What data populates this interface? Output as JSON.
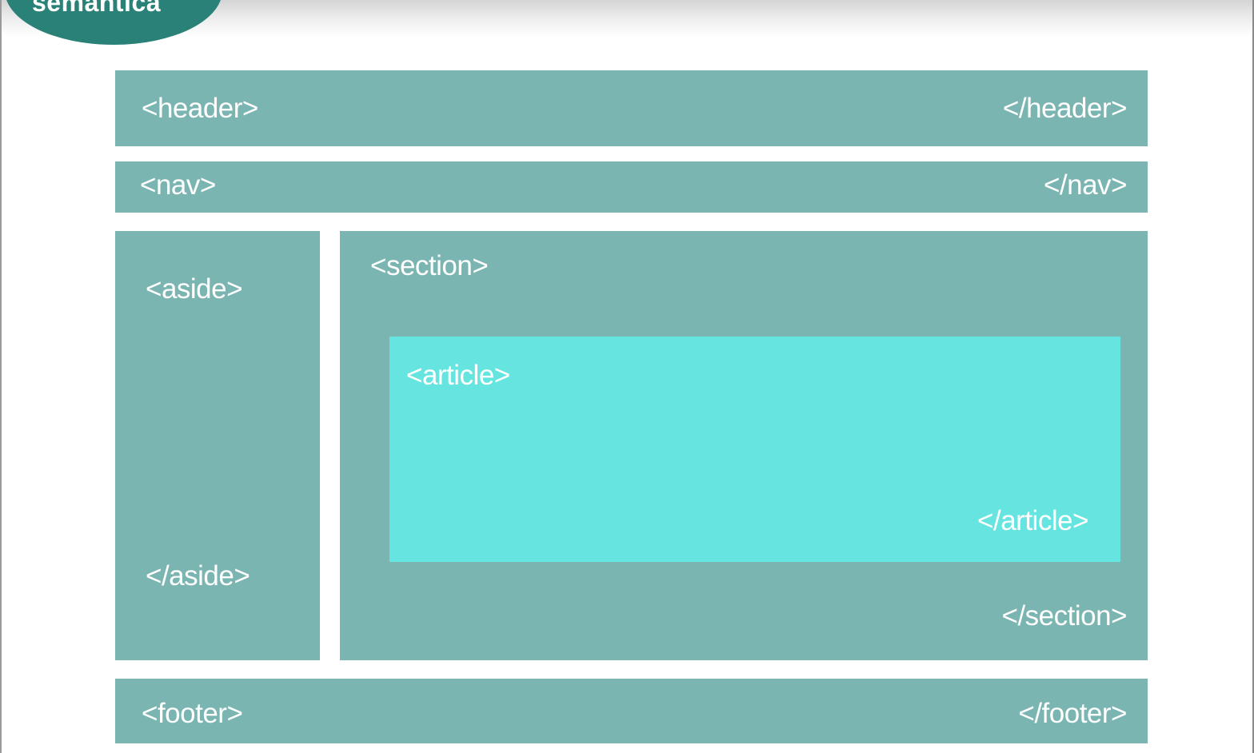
{
  "badge": {
    "label": "semantica"
  },
  "header": {
    "open": "<header>",
    "close": "</header>"
  },
  "nav": {
    "open": "<nav>",
    "close": "</nav>"
  },
  "aside": {
    "open": "<aside>",
    "close": "</aside>"
  },
  "section": {
    "open": "<section>",
    "close": "</section>"
  },
  "article": {
    "open": "<article>",
    "close": "</article>"
  },
  "footer": {
    "open": "<footer>",
    "close": "</footer>"
  },
  "colors": {
    "block": "#7ab5b2",
    "article": "#66e5e0",
    "badge": "#2a8178",
    "text": "#ffffff"
  }
}
